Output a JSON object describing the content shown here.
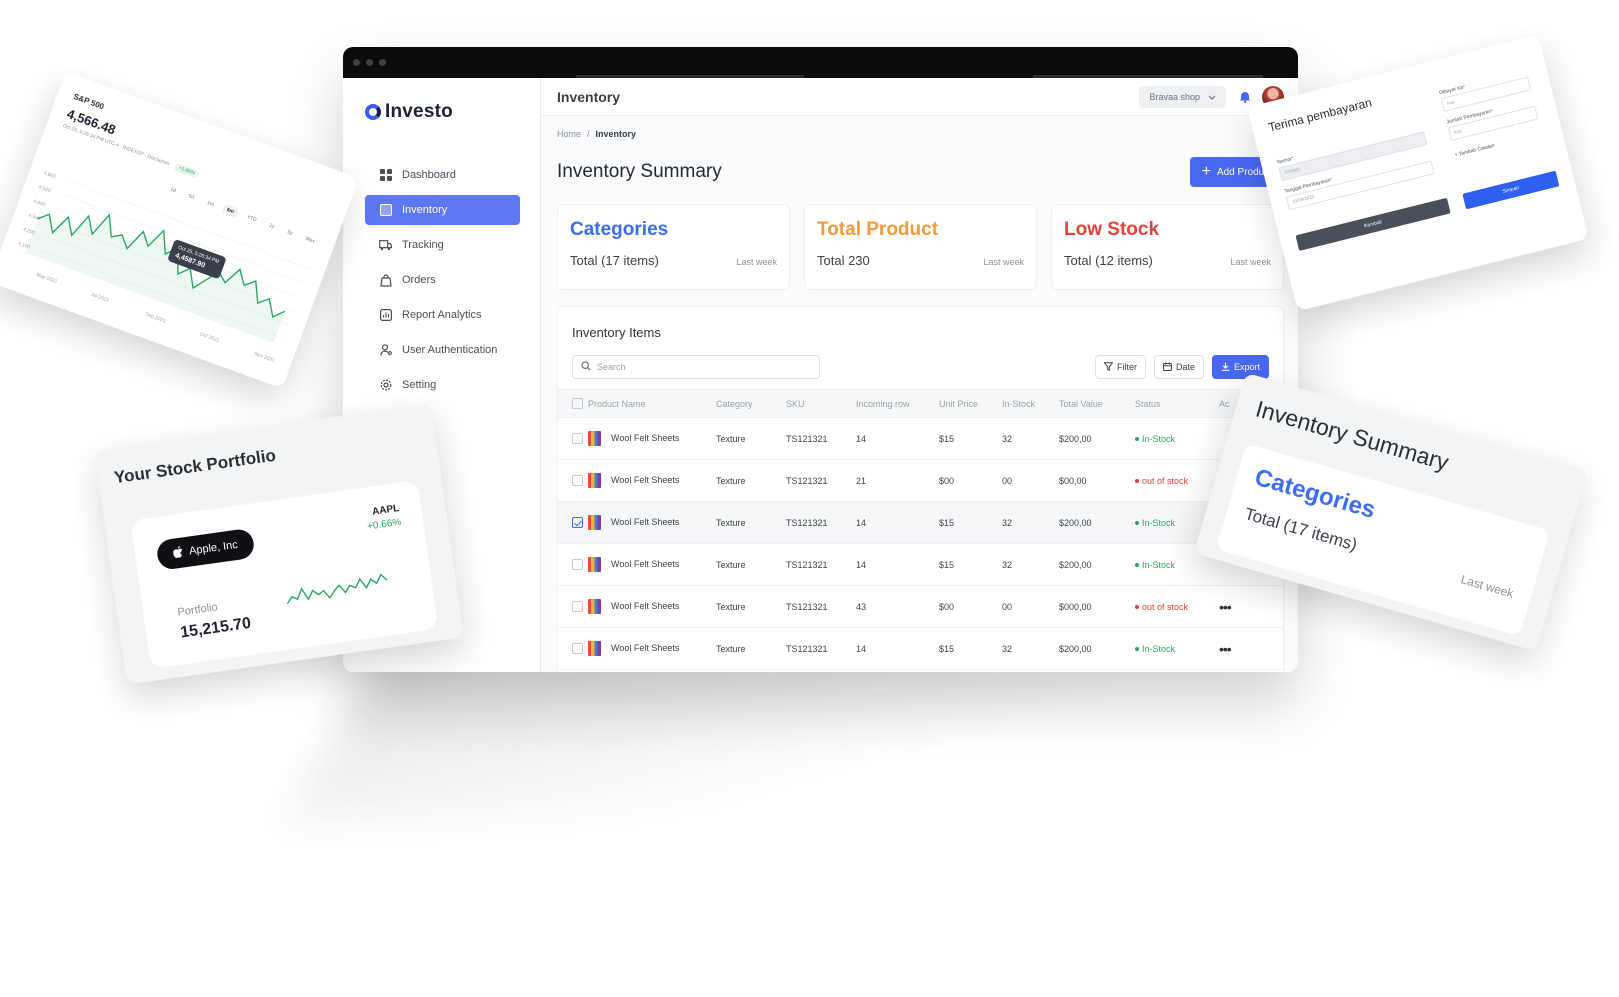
{
  "app": {
    "brand": "Investo",
    "page_label": "Inventory",
    "shop": "Bravaa shop"
  },
  "sidebar": {
    "items": [
      {
        "label": "Dashboard",
        "icon": "grid-icon"
      },
      {
        "label": "Inventory",
        "icon": "box-icon",
        "active": true
      },
      {
        "label": "Tracking",
        "icon": "truck-icon"
      },
      {
        "label": "Orders",
        "icon": "bag-icon"
      },
      {
        "label": "Report Analytics",
        "icon": "chart-icon"
      },
      {
        "label": "User Authentication",
        "icon": "user-icon"
      },
      {
        "label": "Setting",
        "icon": "gear-icon"
      }
    ]
  },
  "breadcrumb": {
    "home": "Home",
    "sep": "/",
    "current": "Inventory"
  },
  "summary": {
    "title": "Inventory Summary",
    "add_label": "Add Product",
    "cards": [
      {
        "title": "Categories",
        "total": "Total (17 items)",
        "period": "Last week",
        "color": "#3d6ef0"
      },
      {
        "title": "Total Product",
        "total": "Total 230",
        "period": "Last week",
        "color": "#f29a3a"
      },
      {
        "title": "Low Stock",
        "total": "Total (12 items)",
        "period": "Last week",
        "color": "#e0443a"
      }
    ]
  },
  "items": {
    "title": "Inventory Items",
    "search_placeholder": "Search",
    "filter_label": "Filter",
    "date_label": "Date",
    "export_label": "Export",
    "columns": [
      "Product Name",
      "Category",
      "SKU",
      "Incoming row",
      "Unit Price",
      "In-Stock",
      "Total Value",
      "Status",
      "Ac"
    ],
    "rows": [
      {
        "name": "Wool Felt Sheets",
        "category": "Texture",
        "sku": "TS121321",
        "incoming": "14",
        "price": "$15",
        "stock": "32",
        "total": "$200,00",
        "status": "In-Stock",
        "status_color": "#2aa763",
        "checked": false,
        "more": ""
      },
      {
        "name": "Wool Felt Sheets",
        "category": "Texture",
        "sku": "TS121321",
        "incoming": "21",
        "price": "$00",
        "stock": "00",
        "total": "$00,00",
        "status": "out of stock",
        "status_color": "#e0443a",
        "checked": false,
        "more": ""
      },
      {
        "name": "Wool Felt Sheets",
        "category": "Texture",
        "sku": "TS121321",
        "incoming": "14",
        "price": "$15",
        "stock": "32",
        "total": "$200,00",
        "status": "In-Stock",
        "status_color": "#2aa763",
        "checked": true,
        "more": ""
      },
      {
        "name": "Wool Felt Sheets",
        "category": "Texture",
        "sku": "TS121321",
        "incoming": "14",
        "price": "$15",
        "stock": "32",
        "total": "$200,00",
        "status": "In-Stock",
        "status_color": "#2aa763",
        "checked": false,
        "more": ""
      },
      {
        "name": "Wool Felt Sheets",
        "category": "Texture",
        "sku": "TS121321",
        "incoming": "43",
        "price": "$00",
        "stock": "00",
        "total": "$000,00",
        "status": "out of stock",
        "status_color": "#e0443a",
        "checked": false,
        "more": "•••"
      },
      {
        "name": "Wool Felt Sheets",
        "category": "Texture",
        "sku": "TS121321",
        "incoming": "14",
        "price": "$15",
        "stock": "32",
        "total": "$200,00",
        "status": "In-Stock",
        "status_color": "#2aa763",
        "checked": false,
        "more": "•••"
      }
    ]
  },
  "sp500": {
    "ticker": "S&P 500",
    "price": "4,566.48",
    "change": "+1.66%",
    "meta": "Oct 25, 5:26:34 PM UTC-4 · INDEXSP · Disclaimer",
    "ranges": [
      "1d",
      "5d",
      "1m",
      "6m",
      "YTD",
      "1y",
      "5y",
      "Max"
    ],
    "active_range": "6m",
    "y_ticks": [
      "4,600",
      "4,500",
      "4,400",
      "4,300",
      "4,200",
      "4,100"
    ],
    "x_ticks": [
      "May 2021",
      "Jul 2021",
      "Sep 2021",
      "Oct 2021",
      "Nov 2021"
    ],
    "tooltip_time": "Oct 25, 5:26:34 PM",
    "tooltip_value": "4,4587.90",
    "series": [
      0.45,
      0.55,
      0.35,
      0.6,
      0.4,
      0.7,
      0.5,
      0.8,
      0.55,
      0.62,
      0.48,
      0.75,
      0.6,
      0.85,
      0.58,
      0.7,
      0.4,
      0.52,
      0.3,
      0.45,
      0.6,
      0.5,
      0.72,
      0.55,
      0.65,
      0.4,
      0.5,
      0.3,
      0.42
    ]
  },
  "portfolio": {
    "title": "Your Stock Portfolio",
    "company": "Apple, Inc",
    "ticker": "AAPL",
    "change": "+0.66%",
    "label": "Portfolio",
    "value": "15,215.70",
    "series": [
      0.3,
      0.5,
      0.4,
      0.7,
      0.35,
      0.6,
      0.45,
      0.55,
      0.3,
      0.5,
      0.65,
      0.4,
      0.6,
      0.5,
      0.75,
      0.45,
      0.7,
      0.55,
      0.8,
      0.6
    ]
  },
  "payment": {
    "title": "Terima pembayaran",
    "nomor_label": "Nomor",
    "nomor_value": "PY0001",
    "tanggal_label": "Tanggal Pembayaran",
    "tanggal_value": "23/09/2023",
    "dibayar_label": "Dibayar Ke",
    "dibayar_value": "Kas",
    "jumlah_label": "Jumlah Pembayaran",
    "jumlah_value": "Kas",
    "catatan_label": "+ Tambah Catatan",
    "back_label": "Kembali",
    "save_label": "Simpan"
  },
  "inv_zoom": {
    "title": "Inventory Summary",
    "category": "Categories",
    "total": "Total (17 items)",
    "period": "Last week"
  }
}
